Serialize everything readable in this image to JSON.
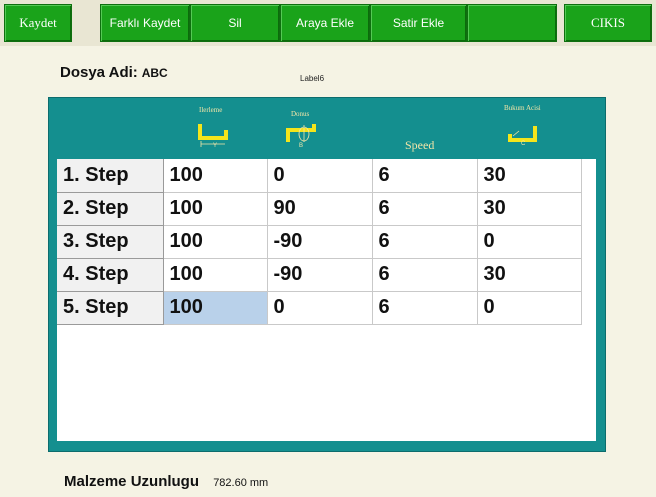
{
  "toolbar": {
    "buttons": [
      {
        "label": "Kaydet"
      },
      {
        "label": "Farklı Kaydet"
      },
      {
        "label": "Sil"
      },
      {
        "label": "Araya Ekle"
      },
      {
        "label": "Satir Ekle"
      },
      {
        "label": ""
      },
      {
        "label": "CIKIS"
      }
    ]
  },
  "file": {
    "label": "Dosya Adi:",
    "name": "ABC"
  },
  "label6": "Label6",
  "table": {
    "headers": [
      {
        "caption": "Ilerleme",
        "icon": "feed-y-icon",
        "sub": "Y"
      },
      {
        "caption": "Donus",
        "icon": "rotation-b-icon",
        "sub": "B"
      },
      {
        "caption": "Speed",
        "icon": "",
        "sub": ""
      },
      {
        "caption": "Bukum Acisi",
        "icon": "bend-angle-c-icon",
        "sub": "C"
      }
    ],
    "rows": [
      {
        "step": "1. Step",
        "y": "100",
        "b": "0",
        "speed": "6",
        "c": "30"
      },
      {
        "step": "2. Step",
        "y": "100",
        "b": "90",
        "speed": "6",
        "c": "30"
      },
      {
        "step": "3. Step",
        "y": "100",
        "b": "-90",
        "speed": "6",
        "c": "0"
      },
      {
        "step": "4. Step",
        "y": "100",
        "b": "-90",
        "speed": "6",
        "c": "30"
      },
      {
        "step": "5. Step",
        "y": "100",
        "b": "0",
        "speed": "6",
        "c": "0"
      }
    ],
    "selected_cell": {
      "row": 5,
      "column": "y"
    }
  },
  "material": {
    "label": "Malzeme Uzunlugu",
    "value": "782.60 mm"
  },
  "colors": {
    "button_green": "#1aa31a",
    "panel_teal": "#148f8f",
    "icon_yellow": "#f5e51b",
    "selection": "#b9d1ea"
  }
}
